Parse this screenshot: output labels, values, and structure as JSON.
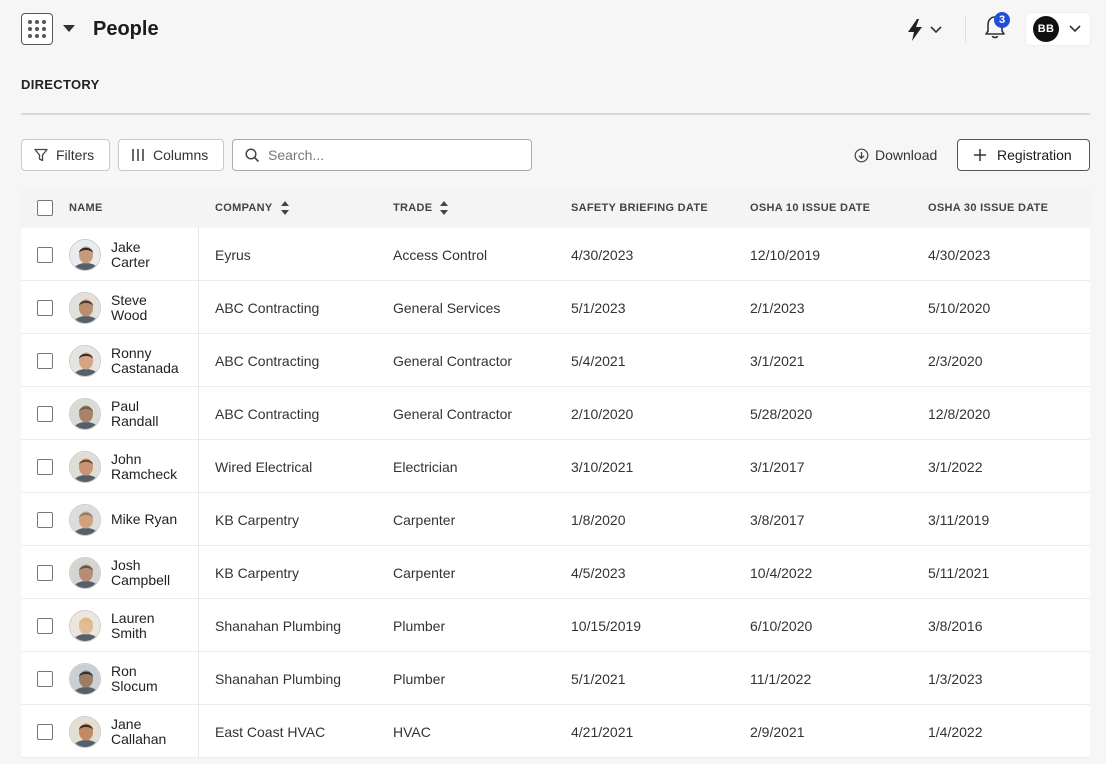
{
  "header": {
    "title": "People",
    "notifications_count": "3",
    "user_initials": "BB"
  },
  "section": {
    "title": "DIRECTORY"
  },
  "toolbar": {
    "filters_label": "Filters",
    "columns_label": "Columns",
    "search_placeholder": "Search...",
    "download_label": "Download",
    "registration_label": "Registration"
  },
  "table": {
    "columns": {
      "name": "NAME",
      "company": "COMPANY",
      "trade": "TRADE",
      "safety": "SAFETY BRIEFING DATE",
      "osha10": "OSHA 10 ISSUE DATE",
      "osha30": "OSHA 30 ISSUE DATE"
    },
    "rows": [
      {
        "first": "Jake",
        "last": "Carter",
        "company": "Eyrus",
        "trade": "Access Control",
        "safety": "4/30/2023",
        "osha10": "12/10/2019",
        "osha30": "4/30/2023"
      },
      {
        "first": "Steve",
        "last": "Wood",
        "company": "ABC Contracting",
        "trade": "General Services",
        "safety": "5/1/2023",
        "osha10": "2/1/2023",
        "osha30": "5/10/2020"
      },
      {
        "first": "Ronny",
        "last": "Castanada",
        "company": "ABC Contracting",
        "trade": "General Contractor",
        "safety": "5/4/2021",
        "osha10": "3/1/2021",
        "osha30": "2/3/2020"
      },
      {
        "first": "Paul",
        "last": "Randall",
        "company": "ABC Contracting",
        "trade": "General Contractor",
        "safety": "2/10/2020",
        "osha10": "5/28/2020",
        "osha30": "12/8/2020"
      },
      {
        "first": "John",
        "last": "Ramcheck",
        "company": "Wired Electrical",
        "trade": "Electrician",
        "safety": "3/10/2021",
        "osha10": "3/1/2017",
        "osha30": "3/1/2022"
      },
      {
        "first": "Mike Ryan",
        "last": "",
        "company": "KB Carpentry",
        "trade": "Carpenter",
        "safety": "1/8/2020",
        "osha10": "3/8/2017",
        "osha30": "3/11/2019"
      },
      {
        "first": "Josh",
        "last": "Campbell",
        "company": "KB Carpentry",
        "trade": "Carpenter",
        "safety": "4/5/2023",
        "osha10": "10/4/2022",
        "osha30": "5/11/2021"
      },
      {
        "first": "Lauren",
        "last": "Smith",
        "company": "Shanahan Plumbing",
        "trade": "Plumber",
        "safety": "10/15/2019",
        "osha10": "6/10/2020",
        "osha30": "3/8/2016"
      },
      {
        "first": "Ron",
        "last": "Slocum",
        "company": "Shanahan Plumbing",
        "trade": "Plumber",
        "safety": "5/1/2021",
        "osha10": "11/1/2022",
        "osha30": "1/3/2023"
      },
      {
        "first": "Jane",
        "last": "Callahan",
        "company": "East Coast HVAC",
        "trade": "HVAC",
        "safety": "4/21/2021",
        "osha10": "2/9/2021",
        "osha30": "1/4/2022"
      }
    ]
  },
  "colors": {
    "accent": "#1f4fd6",
    "avatar_skin": [
      "#c89a7a",
      "#b98d6e",
      "#d4a584",
      "#a8826a",
      "#c99474",
      "#d0a07f",
      "#b58c74",
      "#e2bc98",
      "#9c7c63",
      "#c08a66"
    ],
    "avatar_hair": [
      "#2b2b2b",
      "#4a3a2e",
      "#3a2f28",
      "#6b5f57",
      "#6d4b33",
      "#8a7f76",
      "#5d554e",
      "#d8b77a",
      "#2e2e2e",
      "#3b2a20"
    ],
    "avatar_bg": [
      "#e8ecef",
      "#e3e0dc",
      "#e6e4e0",
      "#d8dcd4",
      "#e0dcd6",
      "#dcdcdc",
      "#d6d4d0",
      "#ece6dc",
      "#c9cfd4",
      "#e4ddd2"
    ]
  }
}
